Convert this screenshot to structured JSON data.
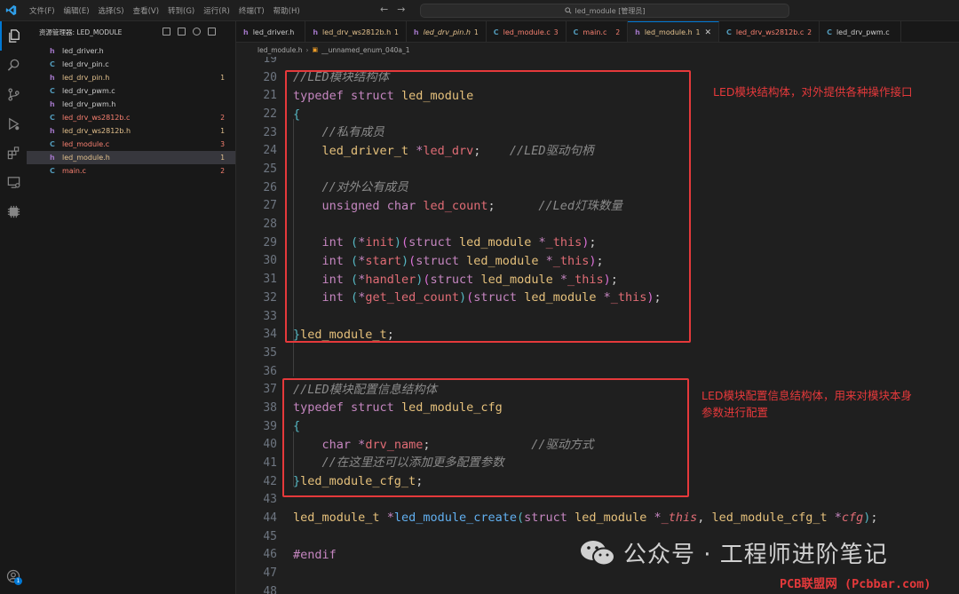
{
  "titlebar": {
    "menu": [
      "文件(F)",
      "编辑(E)",
      "选择(S)",
      "查看(V)",
      "转到(G)",
      "运行(R)",
      "终端(T)",
      "帮助(H)"
    ],
    "search_text": "led_module [管理员]"
  },
  "sidebar": {
    "title": "资源管理器: LED_MODULE",
    "files": [
      {
        "name": "led_driver.h",
        "kind": "h",
        "count": "",
        "color": "white"
      },
      {
        "name": "led_drv_pin.c",
        "kind": "c",
        "count": "",
        "color": "white"
      },
      {
        "name": "led_drv_pin.h",
        "kind": "h",
        "count": "1",
        "color": "orange"
      },
      {
        "name": "led_drv_pwm.c",
        "kind": "c",
        "count": "",
        "color": "white"
      },
      {
        "name": "led_drv_pwm.h",
        "kind": "h",
        "count": "",
        "color": "white"
      },
      {
        "name": "led_drv_ws2812b.c",
        "kind": "c",
        "count": "2",
        "color": "red"
      },
      {
        "name": "led_drv_ws2812b.h",
        "kind": "h",
        "count": "1",
        "color": "orange"
      },
      {
        "name": "led_module.c",
        "kind": "c",
        "count": "3",
        "color": "red"
      },
      {
        "name": "led_module.h",
        "kind": "h",
        "count": "1",
        "color": "orange"
      },
      {
        "name": "main.c",
        "kind": "c",
        "count": "2",
        "color": "red"
      }
    ]
  },
  "tabs": [
    {
      "name": "led_driver.h",
      "kind": "h",
      "mark": "",
      "color": "white"
    },
    {
      "name": "led_drv_ws2812b.h",
      "kind": "h",
      "mark": "1",
      "color": "orange"
    },
    {
      "name": "led_drv_pin.h",
      "kind": "h",
      "mark": "1",
      "color": "orange"
    },
    {
      "name": "led_module.c",
      "kind": "c",
      "mark": "3",
      "color": "red"
    },
    {
      "name": "main.c",
      "kind": "c",
      "mark": "2",
      "color": "red"
    },
    {
      "name": "led_module.h",
      "kind": "h",
      "mark": "1",
      "color": "orange",
      "active": true
    },
    {
      "name": "led_drv_ws2812b.c",
      "kind": "c",
      "mark": "2",
      "color": "red"
    },
    {
      "name": "led_drv_pwm.c",
      "kind": "c",
      "mark": "",
      "color": "white"
    }
  ],
  "breadcrumb": {
    "file": "led_module.h",
    "symbol": "__unnamed_enum_040a_1"
  },
  "code": {
    "first_line_number": 19,
    "line_numbers": [
      "19",
      "20",
      "21",
      "22",
      "23",
      "24",
      "25",
      "26",
      "27",
      "28",
      "29",
      "30",
      "31",
      "32",
      "33",
      "34",
      "35",
      "36",
      "37",
      "38",
      "39",
      "40",
      "41",
      "42",
      "43",
      "44",
      "45",
      "46",
      "47",
      "48"
    ]
  },
  "annotations": {
    "box1": "LED模块结构体，对外提供各种操作接口",
    "box2_line1": "LED模块配置信息结构体，用来对模块本身",
    "box2_line2": "参数进行配置"
  },
  "watermarks": {
    "wechat": "公众号 · 工程师进阶笔记",
    "site": "PCB联盟网 (Pcbbar.com)"
  },
  "colors": {
    "accent": "#0078d4",
    "highlight_box": "#e5393b"
  }
}
